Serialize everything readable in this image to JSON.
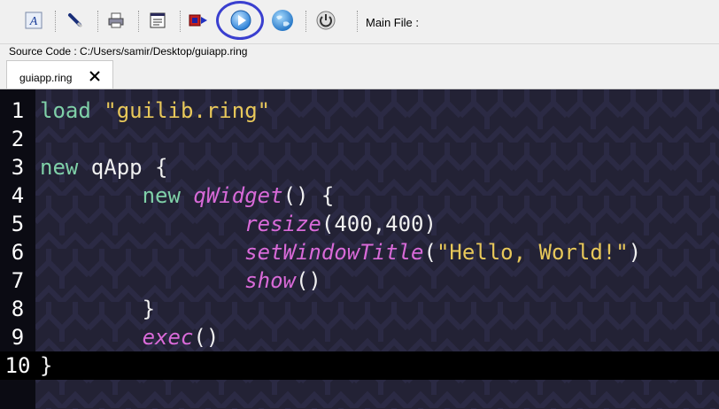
{
  "toolbar": {
    "buttons": [
      {
        "name": "font-icon"
      },
      {
        "name": "pen-icon"
      },
      {
        "name": "print-icon"
      },
      {
        "name": "form-designer-icon"
      },
      {
        "name": "export-icon"
      },
      {
        "name": "run-icon"
      },
      {
        "name": "web-icon"
      },
      {
        "name": "power-icon"
      }
    ],
    "main_file_label": "Main File :"
  },
  "source": {
    "label": "Source Code : C:/Users/samir/Desktop/guiapp.ring"
  },
  "tabs": [
    {
      "label": "guiapp.ring",
      "close_icon": "close-icon"
    }
  ],
  "editor": {
    "current_line": 10,
    "colors": {
      "background": "#232235",
      "gutter": "#0b0b13",
      "keyword": "#7fd0a8",
      "string": "#e8c85a",
      "function": "#d86ad8",
      "run_highlight": "#3a3fcf"
    },
    "lines": [
      {
        "num": "1",
        "tokens": [
          {
            "t": "load",
            "c": "kw"
          },
          {
            "t": " ",
            "c": "plain"
          },
          {
            "t": "\"guilib.ring\"",
            "c": "str"
          }
        ]
      },
      {
        "num": "2",
        "tokens": []
      },
      {
        "num": "3",
        "tokens": [
          {
            "t": "new",
            "c": "kw"
          },
          {
            "t": " qApp {",
            "c": "plain"
          }
        ]
      },
      {
        "num": "4",
        "tokens": [
          {
            "t": "        ",
            "c": "plain"
          },
          {
            "t": "new",
            "c": "kw"
          },
          {
            "t": " ",
            "c": "plain"
          },
          {
            "t": "qWidget",
            "c": "fn"
          },
          {
            "t": "() {",
            "c": "plain"
          }
        ]
      },
      {
        "num": "5",
        "tokens": [
          {
            "t": "                ",
            "c": "plain"
          },
          {
            "t": "resize",
            "c": "fn"
          },
          {
            "t": "(400,400)",
            "c": "plain"
          }
        ]
      },
      {
        "num": "6",
        "tokens": [
          {
            "t": "                ",
            "c": "plain"
          },
          {
            "t": "setWindowTitle",
            "c": "fn"
          },
          {
            "t": "(",
            "c": "plain"
          },
          {
            "t": "\"Hello, World!\"",
            "c": "str"
          },
          {
            "t": ")",
            "c": "plain"
          }
        ]
      },
      {
        "num": "7",
        "tokens": [
          {
            "t": "                ",
            "c": "plain"
          },
          {
            "t": "show",
            "c": "fn"
          },
          {
            "t": "()",
            "c": "plain"
          }
        ]
      },
      {
        "num": "8",
        "tokens": [
          {
            "t": "        }",
            "c": "plain"
          }
        ]
      },
      {
        "num": "9",
        "tokens": [
          {
            "t": "        ",
            "c": "plain"
          },
          {
            "t": "exec",
            "c": "fn"
          },
          {
            "t": "()",
            "c": "plain"
          }
        ]
      },
      {
        "num": "10",
        "tokens": [
          {
            "t": "}",
            "c": "plain"
          }
        ]
      }
    ]
  }
}
